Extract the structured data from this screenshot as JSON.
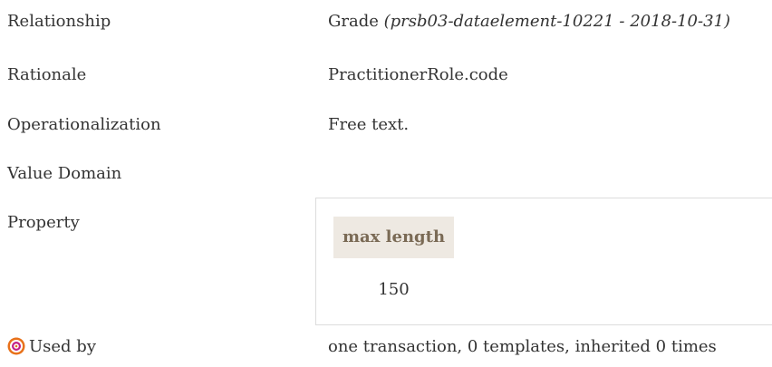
{
  "rows": {
    "relationship": {
      "label": "Relationship",
      "value_main": "Grade",
      "value_ref": "(prsb03-dataelement-10221 - 2018-10-31)"
    },
    "rationale": {
      "label": "Rationale",
      "value": "PractitionerRole.code"
    },
    "operationalization": {
      "label": "Operationalization",
      "value": "Free text."
    },
    "value_domain": {
      "label": "Value Domain"
    },
    "property": {
      "label": "Property",
      "header": "max length",
      "value": "150"
    },
    "used_by": {
      "icon": "target-icon",
      "label": "Used by",
      "value": "one transaction, 0 templates, inherited 0 times"
    }
  },
  "colors": {
    "text": "#333333",
    "header_bg": "#eee9e2",
    "header_text": "#7a6a55",
    "icon_outer": "#e8711a",
    "icon_inner": "#c21f87"
  }
}
